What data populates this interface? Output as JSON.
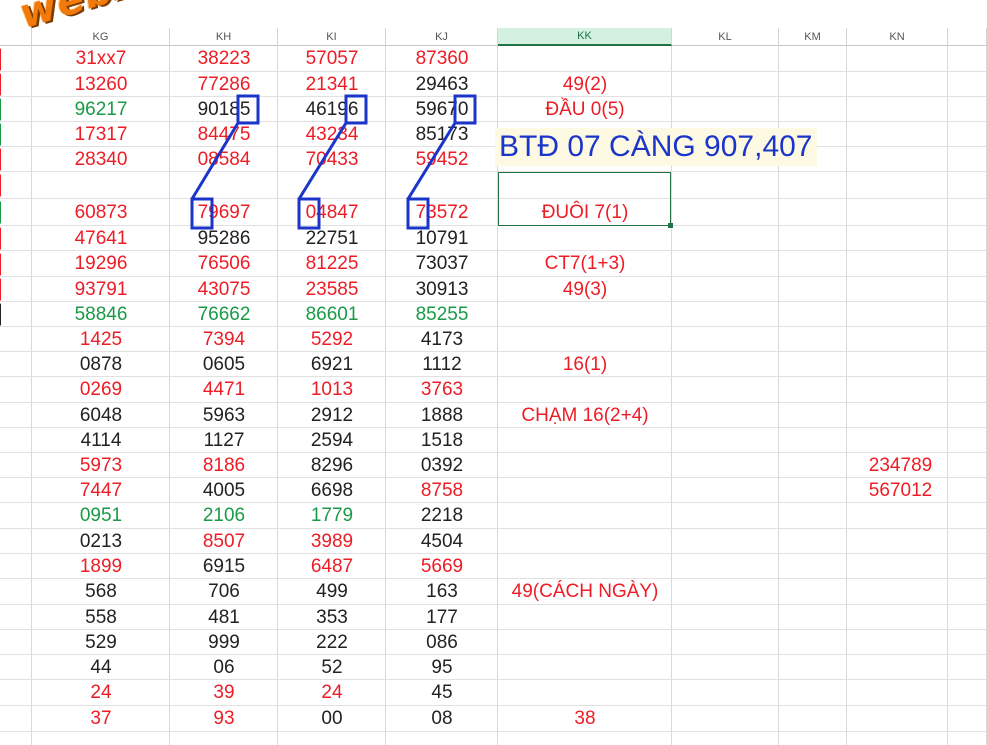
{
  "watermark": "webxoso.net",
  "columns": [
    "KG",
    "KH",
    "KI",
    "KJ",
    "KK",
    "KL",
    "KM",
    "KN"
  ],
  "selected_column": "KK",
  "banner_text": "BTĐ 07 CÀNG 907,407",
  "rows": [
    [
      "31xx7",
      "38223",
      "57057",
      "87360",
      ""
    ],
    [
      "13260",
      "77286",
      "21341",
      "29463",
      "49(2)"
    ],
    [
      "96217",
      "90185",
      "46196",
      "59670",
      "ĐẦU 0(5)"
    ],
    [
      "17317",
      "84475",
      "43234",
      "85173",
      ""
    ],
    [
      "28340",
      "08584",
      "70433",
      "59452",
      ""
    ],
    [
      "",
      "",
      "",
      "",
      ""
    ],
    [
      "60873",
      "79697",
      "04847",
      "73572",
      "ĐUÔI 7(1)"
    ],
    [
      "47641",
      "95286",
      "22751",
      "10791",
      ""
    ],
    [
      "19296",
      "76506",
      "81225",
      "73037",
      "CT7(1+3)"
    ],
    [
      "93791",
      "43075",
      "23585",
      "30913",
      "49(3)"
    ],
    [
      "58846",
      "76662",
      "86601",
      "85255",
      ""
    ],
    [
      "1425",
      "7394",
      "5292",
      "4173",
      ""
    ],
    [
      "0878",
      "0605",
      "6921",
      "1112",
      "16(1)"
    ],
    [
      "0269",
      "4471",
      "1013",
      "3763",
      ""
    ],
    [
      "6048",
      "5963",
      "2912",
      "1888",
      "CHẠM 16(2+4)"
    ],
    [
      "4114",
      "1127",
      "2594",
      "1518",
      ""
    ],
    [
      "5973",
      "8186",
      "8296",
      "0392",
      ""
    ],
    [
      "7447",
      "4005",
      "6698",
      "8758",
      ""
    ],
    [
      "0951",
      "2106",
      "1779",
      "2218",
      ""
    ],
    [
      "0213",
      "8507",
      "3989",
      "4504",
      ""
    ],
    [
      "1899",
      "6915",
      "6487",
      "5669",
      ""
    ],
    [
      "568",
      "706",
      "499",
      "163",
      "49(CÁCH NGÀY)"
    ],
    [
      "558",
      "481",
      "353",
      "177",
      ""
    ],
    [
      "529",
      "999",
      "222",
      "086",
      ""
    ],
    [
      "44",
      "06",
      "52",
      "95",
      ""
    ],
    [
      "24",
      "39",
      "24",
      "45",
      ""
    ],
    [
      "37",
      "93",
      "00",
      "08",
      "38"
    ]
  ],
  "row_colors": [
    [
      "red",
      "red",
      "red",
      "red",
      "red"
    ],
    [
      "red",
      "red",
      "red",
      "blk",
      "red"
    ],
    [
      "grn",
      "blk",
      "blk",
      "blk",
      "red"
    ],
    [
      "red",
      "red",
      "red",
      "blk",
      "red"
    ],
    [
      "red",
      "red",
      "red",
      "red",
      "red"
    ],
    [
      "red",
      "red",
      "red",
      "red",
      "red"
    ],
    [
      "red",
      "red",
      "red",
      "red",
      "red"
    ],
    [
      "red",
      "blk",
      "blk",
      "blk",
      "red"
    ],
    [
      "red",
      "red",
      "red",
      "blk",
      "red"
    ],
    [
      "red",
      "red",
      "red",
      "blk",
      "red"
    ],
    [
      "grn",
      "grn",
      "grn",
      "grn",
      "red"
    ],
    [
      "red",
      "red",
      "red",
      "blk",
      "red"
    ],
    [
      "blk",
      "blk",
      "blk",
      "blk",
      "red"
    ],
    [
      "red",
      "red",
      "red",
      "red",
      "red"
    ],
    [
      "blk",
      "blk",
      "blk",
      "blk",
      "red"
    ],
    [
      "blk",
      "blk",
      "blk",
      "blk",
      "red"
    ],
    [
      "red",
      "red",
      "blk",
      "blk",
      "red"
    ],
    [
      "red",
      "blk",
      "blk",
      "red",
      "red"
    ],
    [
      "grn",
      "grn",
      "grn",
      "blk",
      "red"
    ],
    [
      "blk",
      "red",
      "red",
      "blk",
      "red"
    ],
    [
      "red",
      "blk",
      "red",
      "red",
      "red"
    ],
    [
      "blk",
      "blk",
      "blk",
      "blk",
      "red"
    ],
    [
      "blk",
      "blk",
      "blk",
      "blk",
      "red"
    ],
    [
      "blk",
      "blk",
      "blk",
      "blk",
      "red"
    ],
    [
      "blk",
      "blk",
      "blk",
      "blk",
      "red"
    ],
    [
      "red",
      "red",
      "red",
      "blk",
      "red"
    ],
    [
      "red",
      "red",
      "blk",
      "blk",
      "red"
    ]
  ],
  "row_stub_colors": [
    "red",
    "red",
    "grn",
    "grn",
    "red",
    "red",
    "grn",
    "red",
    "red",
    "red",
    "blk"
  ],
  "kn_cells": [
    {
      "row": 16,
      "text": "234789"
    },
    {
      "row": 17,
      "text": "567012"
    }
  ],
  "colors": {
    "red": "#ee1c25",
    "green": "#1a9a47",
    "blue": "#1b35c9",
    "orange": "#f27a0a",
    "select": "#217346"
  }
}
